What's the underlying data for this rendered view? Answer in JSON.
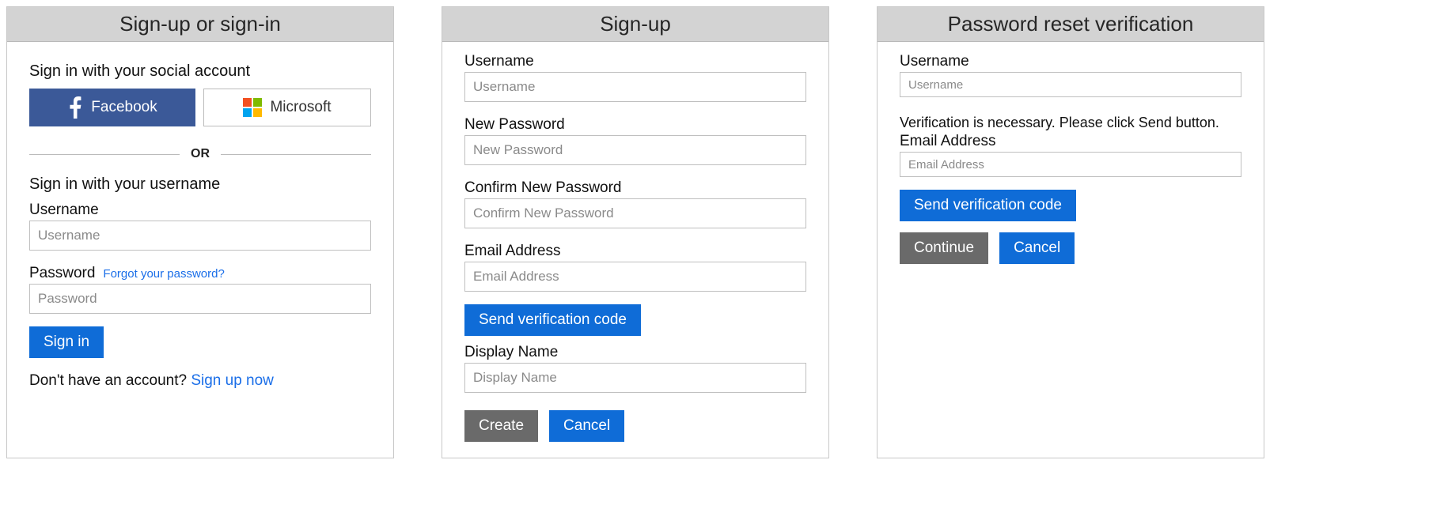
{
  "colors": {
    "primary": "#0f6cd7",
    "secondary": "#6a6a6a",
    "facebook": "#3b5998"
  },
  "panel1": {
    "title": "Sign-up or sign-in",
    "social_heading": "Sign in with your social account",
    "facebook_label": "Facebook",
    "microsoft_label": "Microsoft",
    "divider": "OR",
    "local_heading": "Sign in with your username",
    "username_label": "Username",
    "username_placeholder": "Username",
    "password_label": "Password",
    "forgot_link": "Forgot your password?",
    "password_placeholder": "Password",
    "signin_button": "Sign in",
    "signup_prompt": "Don't have an account? ",
    "signup_link": "Sign up now"
  },
  "panel2": {
    "title": "Sign-up",
    "username_label": "Username",
    "username_placeholder": "Username",
    "newpw_label": "New Password",
    "newpw_placeholder": "New Password",
    "confirmpw_label": "Confirm New Password",
    "confirmpw_placeholder": "Confirm New Password",
    "email_label": "Email Address",
    "email_placeholder": "Email Address",
    "send_code_button": "Send verification code",
    "display_label": "Display Name",
    "display_placeholder": "Display Name",
    "create_button": "Create",
    "cancel_button": "Cancel"
  },
  "panel3": {
    "title": "Password reset verification",
    "username_label": "Username",
    "username_placeholder": "Username",
    "verify_hint": "Verification is necessary. Please click Send button.",
    "email_label": "Email Address",
    "email_placeholder": "Email Address",
    "send_code_button": "Send verification code",
    "continue_button": "Continue",
    "cancel_button": "Cancel"
  }
}
